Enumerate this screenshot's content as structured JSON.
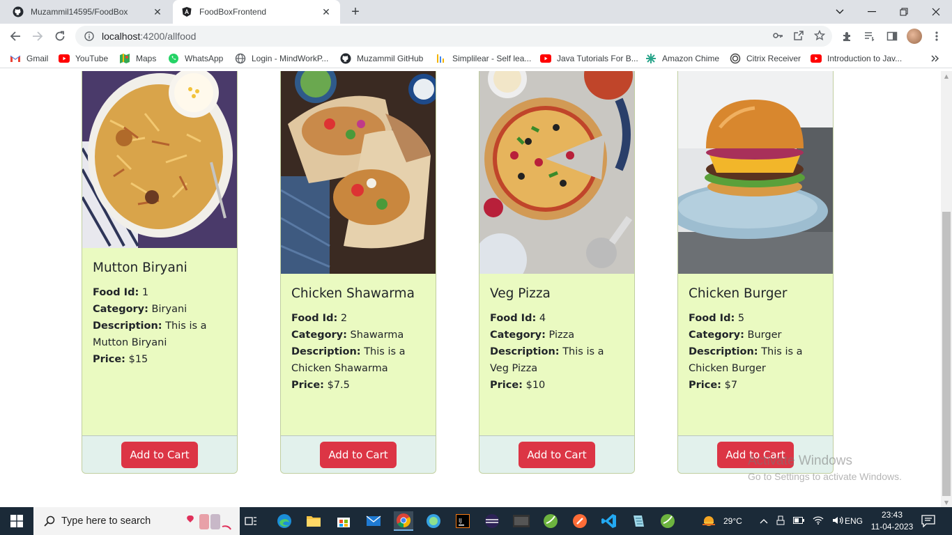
{
  "browser": {
    "tabs": [
      {
        "title": "Muzammil14595/FoodBox",
        "active": false,
        "icon": "github-icon"
      },
      {
        "title": "FoodBoxFrontend",
        "active": true,
        "icon": "angular-icon"
      }
    ],
    "url_host": "localhost",
    "url_rest": ":4200/allfood",
    "bookmarks": [
      {
        "label": "Gmail",
        "icon": "gmail-icon"
      },
      {
        "label": "YouTube",
        "icon": "youtube-icon"
      },
      {
        "label": "Maps",
        "icon": "maps-icon"
      },
      {
        "label": "WhatsApp",
        "icon": "whatsapp-icon"
      },
      {
        "label": "Login - MindWorkP...",
        "icon": "globe-icon"
      },
      {
        "label": "Muzammil GitHub",
        "icon": "github-icon"
      },
      {
        "label": "Simplilear - Self lea...",
        "icon": "simplilearn-icon"
      },
      {
        "label": "Java Tutorials For B...",
        "icon": "youtube-icon"
      },
      {
        "label": "Amazon Chime",
        "icon": "chime-icon"
      },
      {
        "label": "Citrix Receiver",
        "icon": "citrix-icon"
      },
      {
        "label": "Introduction to Jav...",
        "icon": "youtube-icon"
      }
    ]
  },
  "foods": [
    {
      "name": "Mutton Biryani",
      "id": "1",
      "category": "Biryani",
      "description": "This is a Mutton Biryani",
      "price": "$15"
    },
    {
      "name": "Chicken Shawarma",
      "id": "2",
      "category": "Shawarma",
      "description": "This is a Chicken Shawarma",
      "price": "$7.5"
    },
    {
      "name": "Veg Pizza",
      "id": "4",
      "category": "Pizza",
      "description": "This is a Veg Pizza",
      "price": "$10"
    },
    {
      "name": "Chicken Burger",
      "id": "5",
      "category": "Burger",
      "description": "This is a Chicken Burger",
      "price": "$7"
    }
  ],
  "labels": {
    "food_id": "Food Id:",
    "category": "Category:",
    "description": "Description:",
    "price": "Price:",
    "add_to_cart": "Add to Cart"
  },
  "watermark": {
    "line1": "Activate Windows",
    "line2": "Go to Settings to activate Windows."
  },
  "taskbar": {
    "search_placeholder": "Type here to search",
    "weather": "29°C",
    "language": "ENG",
    "time": "23:43",
    "date": "11-04-2023"
  },
  "colors": {
    "card_body": "#eafac1",
    "card_footer": "#e2f1ec",
    "button": "#dc3545"
  }
}
